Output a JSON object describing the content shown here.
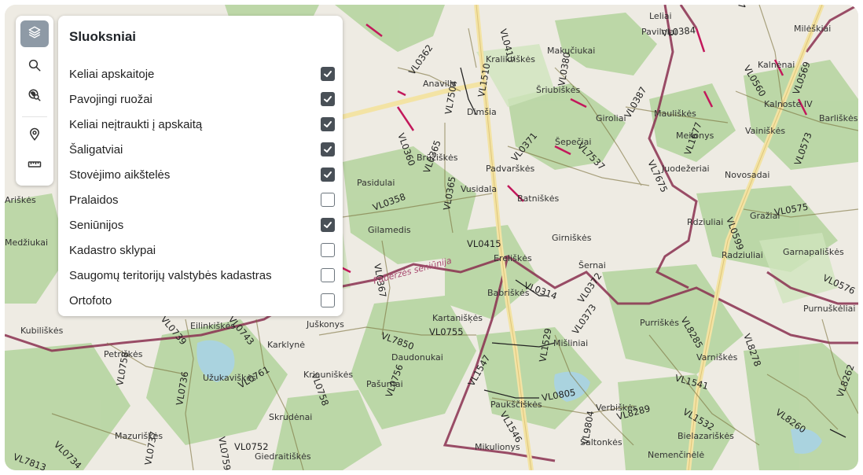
{
  "panel": {
    "title": "Sluoksniai",
    "layers": [
      {
        "label": "Keliai apskaitoje",
        "checked": true
      },
      {
        "label": "Pavojingi ruožai",
        "checked": true
      },
      {
        "label": "Keliai neįtraukti į apskaitą",
        "checked": true
      },
      {
        "label": "Šaligatviai",
        "checked": true
      },
      {
        "label": "Stovėjimo aikštelės",
        "checked": true
      },
      {
        "label": "Pralaidos",
        "checked": false
      },
      {
        "label": "Seniūnijos",
        "checked": true
      },
      {
        "label": "Kadastro sklypai",
        "checked": false
      },
      {
        "label": "Saugomų teritorijų valstybės kadastras",
        "checked": false
      },
      {
        "label": "Ortofoto",
        "checked": false
      }
    ]
  },
  "toolbar": {
    "buttons": [
      {
        "icon": "layers-icon",
        "active": true
      },
      {
        "icon": "search-icon",
        "active": false
      },
      {
        "icon": "search-location-icon",
        "active": false
      },
      {
        "icon": "location-pin-icon",
        "active": false
      },
      {
        "icon": "ruler-icon",
        "active": false
      }
    ]
  },
  "map": {
    "road_labels": [
      "VL0358",
      "VL0360",
      "VL0365",
      "VL0362",
      "VL0367",
      "VL0415",
      "VL0413",
      "VL0380",
      "VL0371",
      "VL7537",
      "VL7675",
      "VL0599",
      "VL0575",
      "VL0576",
      "VL0372",
      "VL0373",
      "VL1529",
      "VL8285",
      "VL8278",
      "VL1541",
      "VL1532",
      "VL1547",
      "VL7850",
      "VL0755",
      "VL0736",
      "VL0737",
      "VL0739",
      "VL0752",
      "VL0759",
      "VL0734",
      "VL7813",
      "VL0756",
      "VL8289",
      "VL9804",
      "VL0560",
      "VL0384",
      "VL0387",
      "VL1677",
      "VL0573",
      "VL0580",
      "VL0569",
      "VL7504",
      "VL1510",
      "VL0314",
      "VL0805",
      "VL8262",
      "VL8260",
      "VL1546",
      "VL0743",
      "VL0761",
      "VL0758",
      "VL0735"
    ],
    "place_labels": [
      "Kraliktiškės",
      "Makučiukai",
      "Šriubiškės",
      "Anavilis",
      "Dimšia",
      "Giroliai",
      "Šepečiai",
      "Brūžiškės",
      "Padvarškės",
      "Pasidulai",
      "Vusidala",
      "Batniškės",
      "Gilamedis",
      "Ereliškės",
      "Girniškės",
      "Šernai",
      "Babriškės",
      "Kartanišķės",
      "Juškonys",
      "Eilinkiškės",
      "Karklynė",
      "Kriauniškės",
      "Daudonukai",
      "Mišliniai",
      "Purriškės",
      "Varniškės",
      "Užukaviškės",
      "Pašurnai",
      "Petriškės",
      "Kubiliškės",
      "Mazuriškės",
      "Skrudėnai",
      "Giedraitiškės",
      "Verbiškės",
      "Bielazariškės",
      "Nemenčinėlė",
      "Šaltonkės",
      "Mikulionys",
      "Paukščiškės",
      "Juodežeriai",
      "Novosadai",
      "Gražiai",
      "Garnapališkės",
      "Radziuliai",
      "Purnuškėliai",
      "Vainiškės",
      "Kalnėnai",
      "Milėškiai",
      "Barliškės",
      "Meilonys",
      "Kalnoste IV",
      "Leliai",
      "Pavilniai",
      "Rdziuliai",
      "Medžiukai",
      "Ariškės",
      "Mauliškės"
    ],
    "district_label": "Pabėrzės seniūnija"
  }
}
